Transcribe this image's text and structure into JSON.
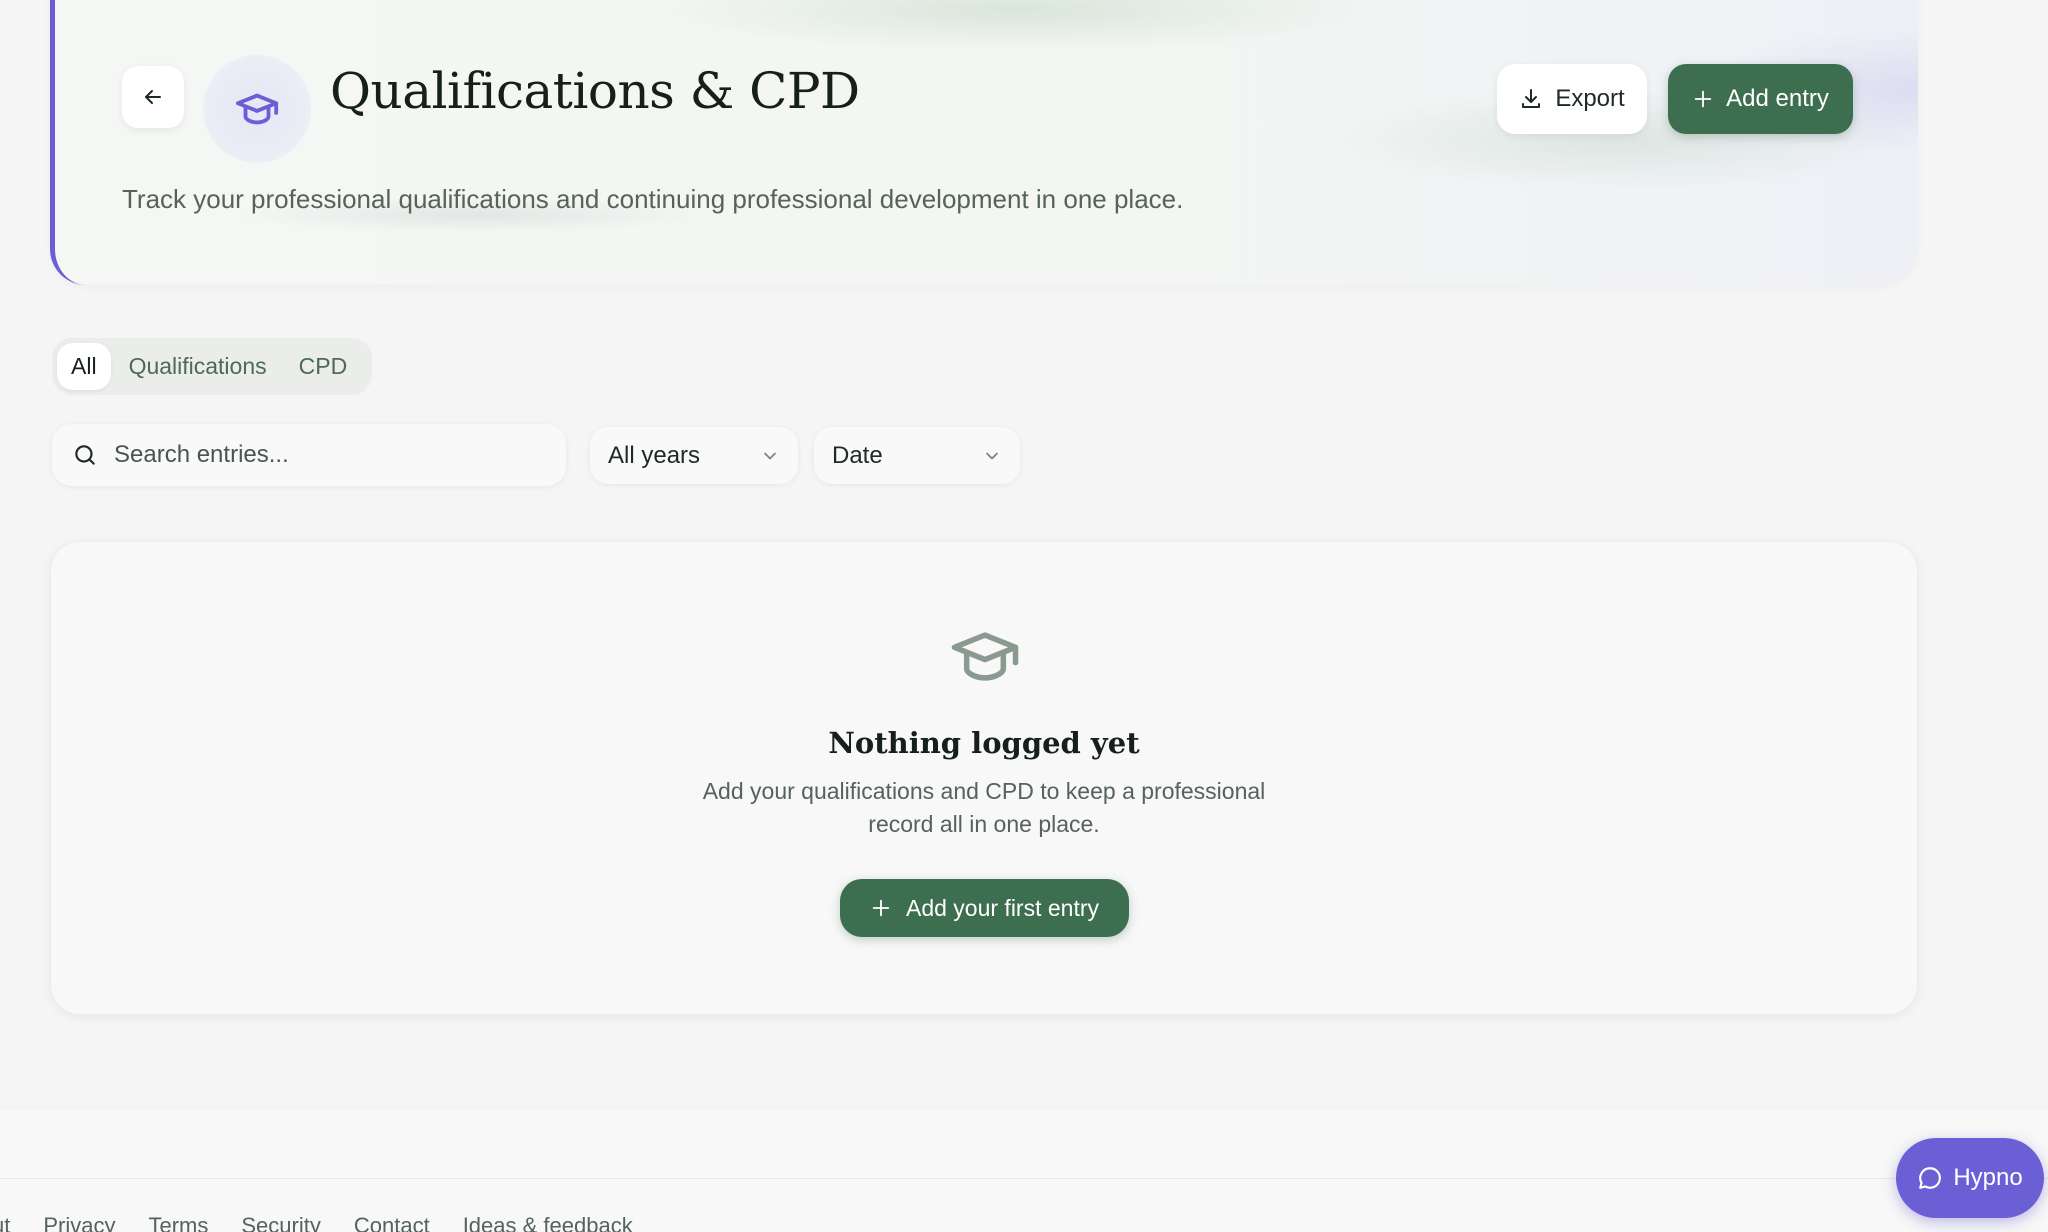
{
  "header": {
    "title": "Qualifications & CPD",
    "subtitle": "Track your professional qualifications and continuing professional development in one place.",
    "back_icon": "arrow-left-icon",
    "section_icon": "graduation-cap-icon",
    "export_label": "Export",
    "add_entry_label": "Add entry",
    "accent_color": "#6b5fd6",
    "primary_color": "#3d6e4f"
  },
  "tabs": [
    {
      "label": "All",
      "active": true
    },
    {
      "label": "Qualifications",
      "active": false
    },
    {
      "label": "CPD",
      "active": false
    }
  ],
  "filters": {
    "search_placeholder": "Search entries...",
    "search_value": "",
    "year_select": "All years",
    "sort_select": "Date"
  },
  "empty_state": {
    "icon": "graduation-cap-icon",
    "title": "Nothing logged yet",
    "text": "Add your qualifications and CPD to keep a professional record all in one place.",
    "button_label": "Add your first entry"
  },
  "footer": {
    "links": [
      "ut",
      "Privacy",
      "Terms",
      "Security",
      "Contact",
      "Ideas & feedback"
    ]
  },
  "chat_widget": {
    "label": "Hypno",
    "icon": "chat-bubble-icon",
    "color": "#6b5fd6"
  }
}
